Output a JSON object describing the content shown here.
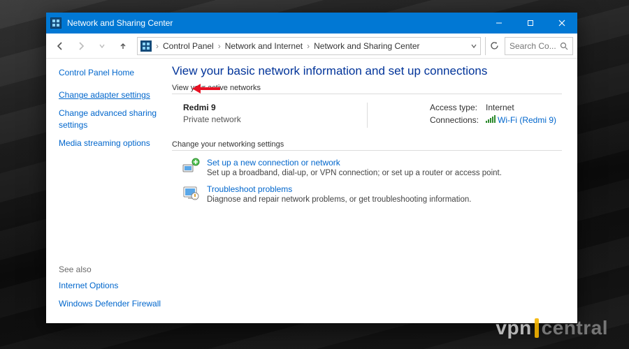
{
  "titlebar": {
    "title": "Network and Sharing Center"
  },
  "breadcrumb": {
    "items": [
      "Control Panel",
      "Network and Internet",
      "Network and Sharing Center"
    ]
  },
  "search": {
    "placeholder": "Search Co..."
  },
  "sidebar": {
    "home": "Control Panel Home",
    "links": [
      "Change adapter settings",
      "Change advanced sharing settings",
      "Media streaming options"
    ],
    "seealso_label": "See also",
    "seealso": [
      "Internet Options",
      "Windows Defender Firewall"
    ]
  },
  "content": {
    "heading": "View your basic network information and set up connections",
    "active_label": "View your active networks",
    "network": {
      "name": "Redmi 9",
      "type": "Private network",
      "access_label": "Access type:",
      "access_value": "Internet",
      "conn_label": "Connections:",
      "conn_value": "Wi-Fi (Redmi 9)"
    },
    "change_label": "Change your networking settings",
    "tasks": [
      {
        "title": "Set up a new connection or network",
        "desc": "Set up a broadband, dial-up, or VPN connection; or set up a router or access point."
      },
      {
        "title": "Troubleshoot problems",
        "desc": "Diagnose and repair network problems, or get troubleshooting information."
      }
    ]
  },
  "watermark": {
    "left": "vpn",
    "right": "central"
  }
}
